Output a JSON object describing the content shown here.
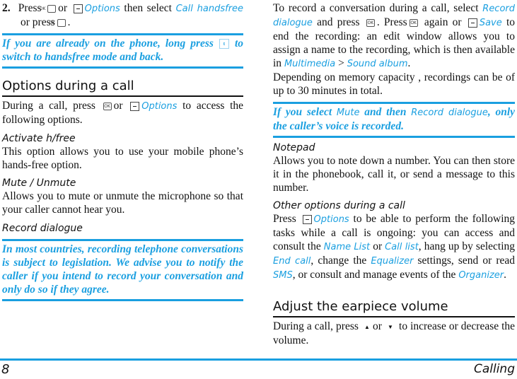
{
  "left": {
    "step": {
      "num": "2.",
      "t1": "Press",
      "t2": "or",
      "options": "Options",
      "t3": "then select",
      "call_handsfree": "Call handsfree",
      "t4": "or press",
      "t5": "."
    },
    "note1": {
      "t1": "If you are already on the phone, long press",
      "t2": "to switch to handsfree mode and back."
    },
    "section_title": "Options during a call",
    "intro": {
      "t1": "During a call, press",
      "t2": "or",
      "options": "Options",
      "t3": "to access the following options."
    },
    "activate": {
      "title": "Activate h/free",
      "body": "This option allows you to use your mobile phone’s hands-free option."
    },
    "mute": {
      "title": "Mute / Unmute",
      "body": "Allows you to mute or unmute the microphone so that your caller cannot hear you."
    },
    "record": {
      "title": "Record dialogue"
    },
    "note2": "In most countries, recording telephone conversations is subject to legislation. We advise you to notify the caller if you intend to record your conversation and only do so if they agree."
  },
  "right": {
    "rec": {
      "t1": "To record a conversation during a call, select",
      "record_dialogue": "Record dialogue",
      "t2": "and press",
      "t3": ". Press",
      "t4": "again or",
      "save": "Save",
      "t5": "to end the recording: an edit window allows you to assign a name to the recording, which is then available in",
      "multimedia": "Multimedia",
      "gt": ">",
      "sound_album": "Sound album",
      "t6": "."
    },
    "memory": "Depending on memory capacity , recordings can be of up to 30 minutes in total.",
    "note3": {
      "t1": "If you select",
      "mute": "Mute",
      "t2": "and then",
      "record": "Record dialogue",
      "t3": ", only the caller’s voice is recorded."
    },
    "notepad": {
      "title": "Notepad",
      "body": "Allows you to note down a number. You can then store it in the phonebook, call it, or send a message to this number."
    },
    "other": {
      "title": "Other options during a call",
      "t1": "Press",
      "options": "Options",
      "t2": "to be able to perform the following tasks while a call is ongoing: you can access and consult the",
      "name_list": "Name List",
      "t3": "or",
      "call_list": "Call list",
      "t4": ", hang up by selecting",
      "end_call": "End call",
      "t5": ", change the",
      "equalizer": "Equalizer",
      "t6": "settings, send or read",
      "sms": "SMS",
      "t7": ", or consult and manage events of the",
      "organizer": "Organizer",
      "t8": "."
    },
    "volume": {
      "title": "Adjust the earpiece volume",
      "t1": "During a call, press",
      "t2": "or",
      "t3": "to increase or decrease the volume."
    }
  },
  "footer": {
    "page": "8",
    "chapter": "Calling"
  },
  "icons": {
    "ok_key": "OK",
    "up_arrow": "▲",
    "down_arrow": "▼",
    "handsfree_key": "t"
  },
  "colors": {
    "accent": "#1a9fe0"
  }
}
